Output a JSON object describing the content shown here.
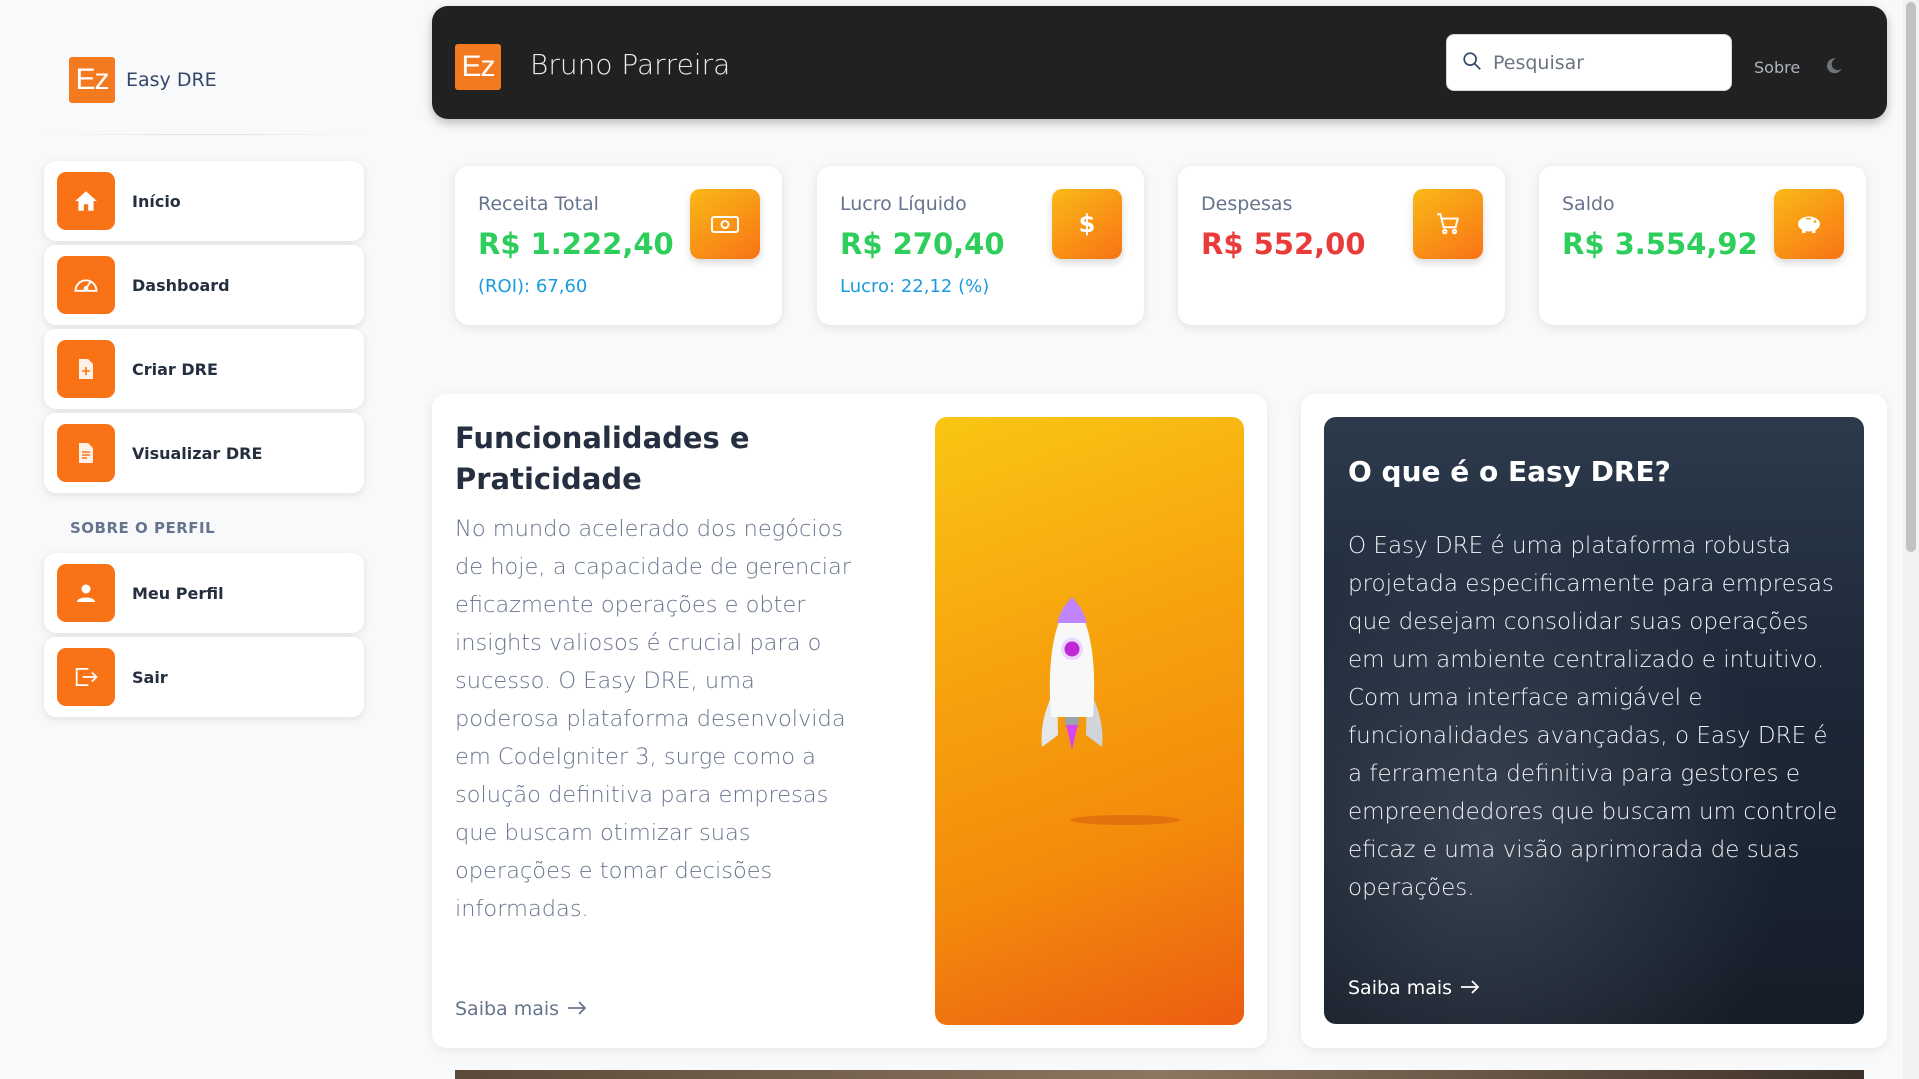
{
  "brand": {
    "logo_text": "Ez",
    "name": "Easy DRE"
  },
  "sidebar": {
    "items": [
      {
        "label": "Início",
        "icon": "home-icon"
      },
      {
        "label": "Dashboard",
        "icon": "speedometer-icon"
      },
      {
        "label": "Criar DRE",
        "icon": "file-add-icon"
      },
      {
        "label": "Visualizar DRE",
        "icon": "file-text-icon"
      }
    ],
    "section_title": "SOBRE O PERFIL",
    "profile_items": [
      {
        "label": "Meu Perfil",
        "icon": "user-icon"
      },
      {
        "label": "Sair",
        "icon": "logout-icon"
      }
    ]
  },
  "topbar": {
    "logo_text": "Ez",
    "user_name": "Bruno Parreira",
    "search_placeholder": "Pesquisar",
    "about_link": "Sobre"
  },
  "stats": [
    {
      "title": "Receita Total",
      "value": "R$ 1.222,40",
      "sub": "(ROI): 67,60",
      "value_color": "#2dce5b",
      "icon": "money-icon"
    },
    {
      "title": "Lucro Líquido",
      "value": "R$ 270,40",
      "sub": "Lucro: 22,12 (%)",
      "value_color": "#2dce5b",
      "icon": "dollar-icon"
    },
    {
      "title": "Despesas",
      "value": "R$ 552,00",
      "sub": "",
      "value_color": "#ea3b3b",
      "icon": "cart-icon"
    },
    {
      "title": "Saldo",
      "value": "R$ 3.554,92",
      "sub": "",
      "value_color": "#2dce5b",
      "icon": "piggy-bank-icon"
    }
  ],
  "feature": {
    "title": "Funcionalidades e Praticidade",
    "text": "No mundo acelerado dos negócios de hoje, a capacidade de gerenciar eficazmente operações e obter insights valiosos é crucial para o sucesso. O Easy DRE, uma poderosa plataforma desenvolvida em CodeIgniter 3, surge como a solução definitiva para empresas que buscam otimizar suas operações e tomar decisões informadas.",
    "more": "Saiba mais"
  },
  "about": {
    "title": "O que é o Easy DRE?",
    "text": "O Easy DRE é uma plataforma robusta projetada especificamente para empresas que desejam consolidar suas operações em um ambiente centralizado e intuitivo. Com uma interface amigável e funcionalidades avançadas, o Easy DRE é a ferramenta definitiva para gestores e empreendedores que buscam um controle eficaz e uma visão aprimorada de suas operações.",
    "more": "Saiba mais"
  },
  "colors": {
    "accent": "#f97316",
    "topbar": "#212121",
    "positive": "#2dce5b",
    "negative": "#ea3b3b",
    "info": "#1a9be0"
  }
}
